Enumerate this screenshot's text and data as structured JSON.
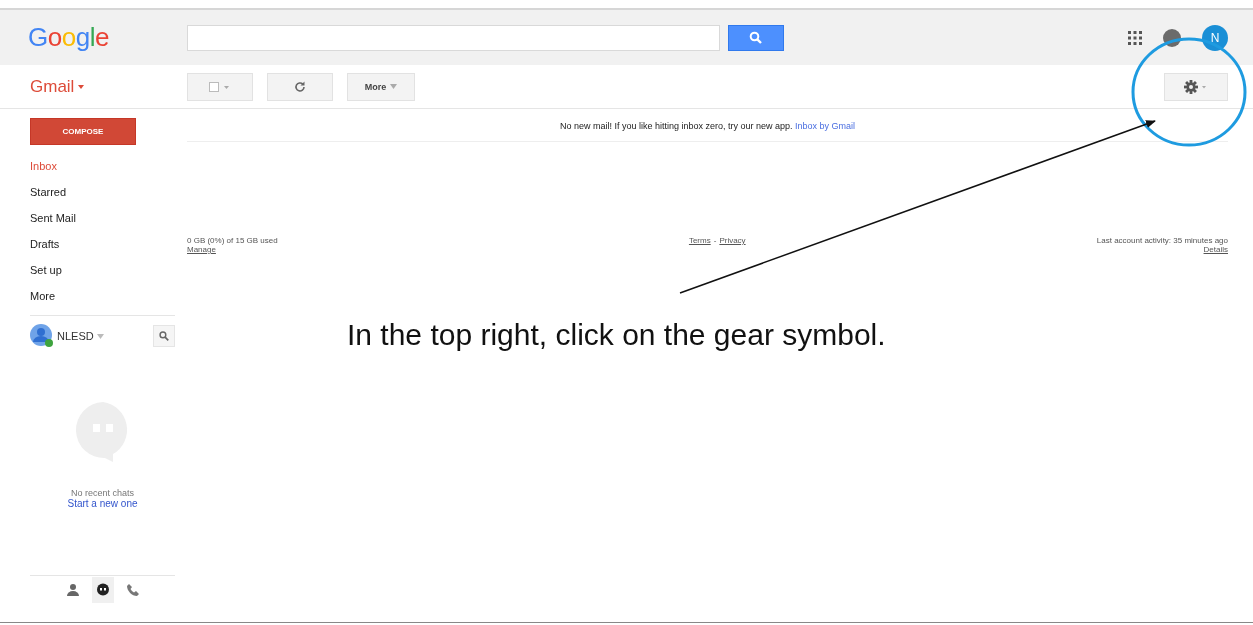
{
  "header": {
    "logo": "Google",
    "avatar": "N"
  },
  "toolbar": {
    "app_menu": "Gmail",
    "more_button": "More"
  },
  "sidebar": {
    "compose": "COMPOSE",
    "items": [
      {
        "label": "Inbox",
        "selected": true
      },
      {
        "label": "Starred",
        "selected": false
      },
      {
        "label": "Sent Mail",
        "selected": false
      },
      {
        "label": "Drafts",
        "selected": false
      },
      {
        "label": "Set up",
        "selected": false
      },
      {
        "label": "More",
        "selected": false
      }
    ],
    "account": "NLESD",
    "chat": {
      "empty_text": "No recent chats",
      "link": "Start a new one"
    }
  },
  "main": {
    "notice": "No new mail! If you like hitting inbox zero, try our new app.",
    "notice_link": "Inbox by Gmail",
    "storage": "0 GB (0%) of 15 GB used",
    "manage": "Manage",
    "terms": "Terms",
    "separator": "-",
    "privacy": "Privacy",
    "activity": "Last account activity: 35 minutes ago",
    "details": "Details"
  },
  "annotation": {
    "caption": "In the top right, click on the gear symbol."
  }
}
